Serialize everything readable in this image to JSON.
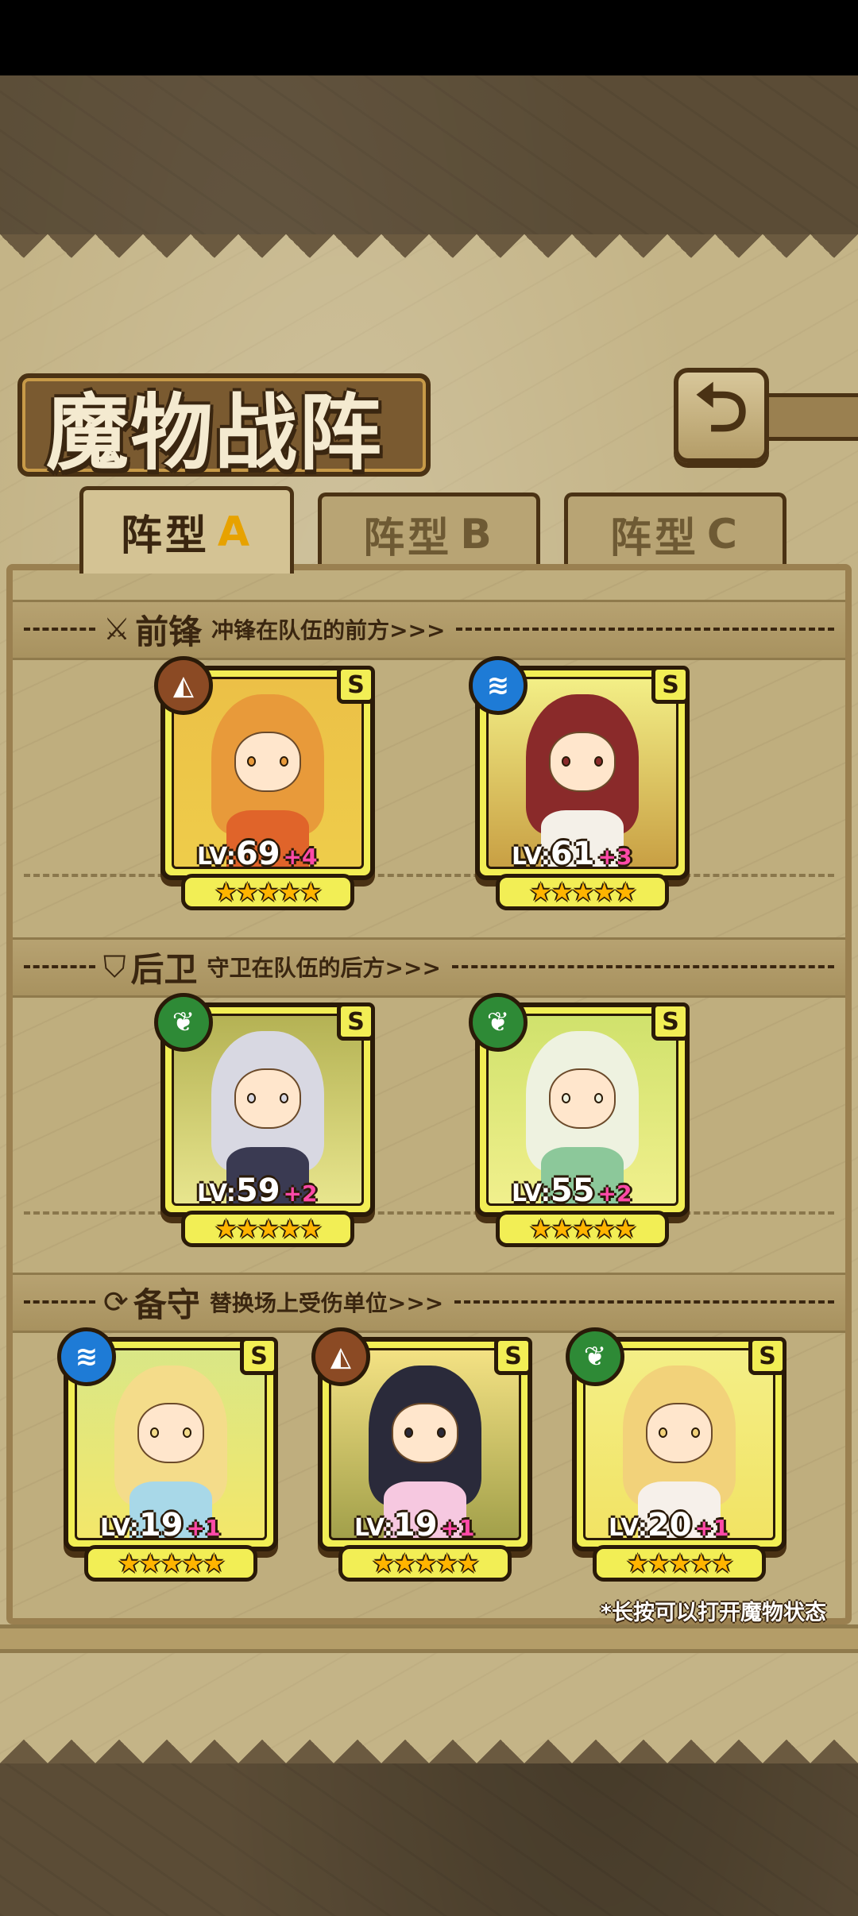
{
  "title": "魔物战阵",
  "back_icon": "back-arrow-icon",
  "tabs": [
    {
      "label": "阵型",
      "suffix": "A",
      "active": true
    },
    {
      "label": "阵型",
      "suffix": "B",
      "active": false
    },
    {
      "label": "阵型",
      "suffix": "C",
      "active": false
    }
  ],
  "sections": {
    "front": {
      "icon": "sword-icon",
      "title": "前锋",
      "desc": "冲锋在队伍的前方>>>"
    },
    "back": {
      "icon": "shield-icon",
      "title": "后卫",
      "desc": "守卫在队伍的后方>>>"
    },
    "reserve": {
      "icon": "swap-icon",
      "title": "备守",
      "desc": "替换场上受伤单位>>>"
    }
  },
  "units": {
    "front": [
      {
        "lv_label": "LV:",
        "level": "69",
        "plus": "+4",
        "rank": "S",
        "element": "earth",
        "stars": "★★★★★",
        "hair_color": "#e89a3a",
        "body_color": "#e0642a"
      },
      {
        "lv_label": "LV:",
        "level": "61",
        "plus": "+3",
        "rank": "S",
        "element": "water",
        "stars": "★★★★★",
        "hair_color": "#8a2a2a",
        "body_color": "#f4f0e8"
      }
    ],
    "back": [
      {
        "lv_label": "LV:",
        "level": "59",
        "plus": "+2",
        "rank": "S",
        "element": "wood",
        "stars": "★★★★★",
        "hair_color": "#d8d8e2",
        "body_color": "#3a3a52"
      },
      {
        "lv_label": "LV:",
        "level": "55",
        "plus": "+2",
        "rank": "S",
        "element": "wood",
        "stars": "★★★★★",
        "hair_color": "#eef2e0",
        "body_color": "#8cc89a"
      }
    ],
    "reserve": [
      {
        "lv_label": "LV:",
        "level": "19",
        "plus": "+1",
        "rank": "S",
        "element": "water",
        "stars": "★★★★★",
        "hair_color": "#f4dc8a",
        "body_color": "#a8d8e8"
      },
      {
        "lv_label": "LV:",
        "level": "19",
        "plus": "+1",
        "rank": "S",
        "element": "earth",
        "stars": "★★★★★",
        "hair_color": "#2a2a3a",
        "body_color": "#f6c8e0"
      },
      {
        "lv_label": "LV:",
        "level": "20",
        "plus": "+1",
        "rank": "S",
        "element": "wood",
        "stars": "★★★★★",
        "hair_color": "#f2d27a",
        "body_color": "#f6f0ea"
      }
    ]
  },
  "hint": "*长按可以打开魔物状态",
  "colors": {
    "accent": "#e7a200",
    "plus": "#ff4aa8",
    "card": "#f2ee55"
  }
}
